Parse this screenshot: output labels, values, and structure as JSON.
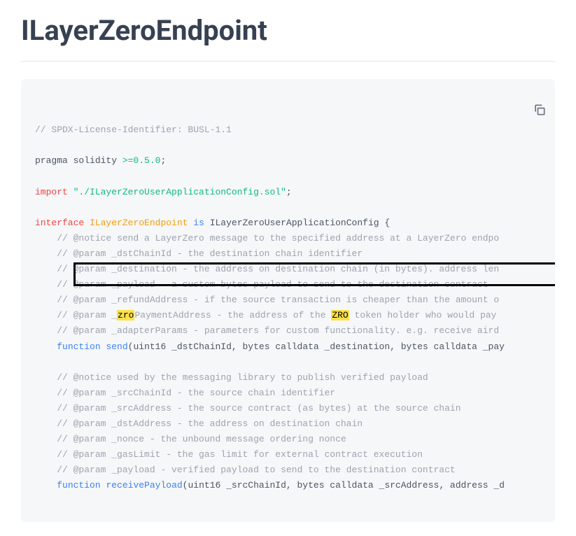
{
  "title": "ILayerZeroEndpoint",
  "code": {
    "spdx": "// SPDX-License-Identifier: BUSL-1.1",
    "pragma_kw": "pragma solidity ",
    "pragma_ver": ">=0.5.0",
    "semicolon": ";",
    "import_kw": "import",
    "import_path": "\"./ILayerZeroUserApplicationConfig.sol\"",
    "interface_kw": "interface",
    "interface_name": "ILayerZeroEndpoint",
    "is_kw": "is",
    "parent": "ILayerZeroUserApplicationConfig",
    "brace_open": " {",
    "c_notice1": "// @notice send a LayerZero message to the specified address at a LayerZero endpo",
    "c_dstChainId": "// @param _dstChainId - the destination chain identifier",
    "c_destination": "// @param _destination - the address on destination chain (in bytes). address len",
    "c_payload": "// @param _payload - a custom bytes payload to send to the destination contract",
    "c_refund": "// @param _refundAddress - if the source transaction is cheaper than the amount o",
    "c_zro_pre": "// @param _",
    "c_zro_hl1": "zro",
    "c_zro_mid": "PaymentAddress - the address of the ",
    "c_zro_hl2": "ZRO",
    "c_zro_post": " token holder who would pay ",
    "c_adapter": "// @param _adapterParams - parameters for custom functionality. e.g. receive aird",
    "fn_kw": "function",
    "fn_send": "send",
    "fn_send_sig": "(uint16 _dstChainId, bytes calldata _destination, bytes calldata _pay",
    "c_notice2": "// @notice used by the messaging library to publish verified payload",
    "c_srcChainId": "// @param _srcChainId - the source chain identifier",
    "c_srcAddress": "// @param _srcAddress - the source contract (as bytes) at the source chain",
    "c_dstAddress": "// @param _dstAddress - the address on destination chain",
    "c_nonce": "// @param _nonce - the unbound message ordering nonce",
    "c_gasLimit": "// @param _gasLimit - the gas limit for external contract execution",
    "c_payload2": "// @param _payload - verified payload to send to the destination contract",
    "fn_receive": "receivePayload",
    "fn_receive_sig": "(uint16 _srcChainId, bytes calldata _srcAddress, address _d"
  }
}
